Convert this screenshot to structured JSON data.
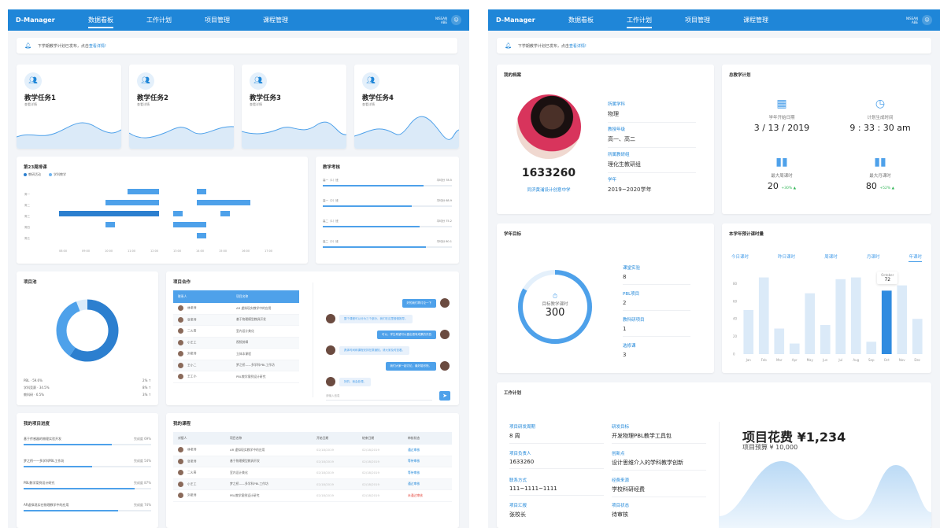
{
  "left": {
    "brand": "D-Manager",
    "nav": [
      "数据看板",
      "工作计划",
      "项目管理",
      "课程管理"
    ],
    "user_name": "NISSAN",
    "user_sub": "ABE",
    "notice_text": "下学期教学计划已发布，点击",
    "notice_link": "查看详情!",
    "tasks": [
      {
        "title": "教学任务1",
        "sub": "查看详情"
      },
      {
        "title": "教学任务2",
        "sub": "查看详情"
      },
      {
        "title": "教学任务3",
        "sub": "查看详情"
      },
      {
        "title": "教学任务4",
        "sub": "查看详情"
      }
    ],
    "schedule": {
      "title": "第23周排课",
      "legend": [
        "教研活动",
        "学科教学"
      ],
      "rows": [
        "周一",
        "周二",
        "周三",
        "周四",
        "周五"
      ],
      "ticks": [
        "08:00",
        "09:00",
        "10:00",
        "11:00",
        "12:00",
        "13:00",
        "14:00",
        "15:00",
        "16:00",
        "17:00"
      ]
    },
    "exam": {
      "title": "教学考核",
      "rows": [
        {
          "label": "高一（1）班",
          "val": "平均分 78.5",
          "pct": 0.8
        },
        {
          "label": "高一（2）班",
          "val": "平均分 68.9",
          "pct": 0.7
        },
        {
          "label": "高二（1）班",
          "val": "平均分 75.2",
          "pct": 0.78
        },
        {
          "label": "高二（2）班",
          "val": "平均分 80.1",
          "pct": 0.82
        }
      ]
    },
    "project_pie": {
      "title": "项目池",
      "items": [
        {
          "label": "PBL · 59.6%",
          "val": "2% ↑"
        },
        {
          "label": "学科竞赛 · 34.5%",
          "val": "8% ↑"
        },
        {
          "label": "教科研 · 6.5%",
          "val": "3% ↑"
        }
      ],
      "values": [
        59.6,
        34.5,
        6.5
      ]
    },
    "collab": {
      "title": "项目合作",
      "headers": [
        "联系人",
        "项目名称"
      ],
      "rows": [
        {
          "name": "林老师",
          "proj": "AR 虚拟现实教学中的应用"
        },
        {
          "name": "张老师",
          "proj": "基于物理模型教具开发"
        },
        {
          "name": "二火哥",
          "proj": "室内设计美化"
        },
        {
          "name": "小王工",
          "proj": "视频剪辑"
        },
        {
          "name": "刘老师",
          "proj": "立体本课程"
        },
        {
          "name": "王小二",
          "proj": "梦之桥——多学科PBL工作坊"
        },
        {
          "name": "王工小",
          "proj": "PBL教学案例设计研究"
        }
      ],
      "chat": [
        "好的我们再讨论一下",
        "整个课程可以分为三个部分，我们在这里慢慢推导。",
        "可以，学生希望可以做出很有成果的东西",
        "具体时间和课程安排在群通知，请大家及时查看。",
        "我们大家一起讨论，最好能尽快。",
        "好的，我会处理。"
      ],
      "chat_placeholder": "请输入信息"
    },
    "my_projects": {
      "title": "我的项目进度",
      "rows": [
        {
          "label": "基于传感器的物理实验开发",
          "val": "完成度 69%",
          "pct": 0.69
        },
        {
          "label": "梦之桥——多学科PBL工作坊",
          "val": "完成度 54%",
          "pct": 0.54
        },
        {
          "label": "PBL数学案例设计研究",
          "val": "完成度 87%",
          "pct": 0.87
        },
        {
          "label": "AR虚拟现实在物理教学中的应用",
          "val": "完成度 74%",
          "pct": 0.74
        }
      ]
    },
    "my_courses": {
      "title": "我的课程",
      "headers": [
        "对接人",
        "项目名称",
        "开始日期",
        "结束日期",
        "审核状态"
      ],
      "rows": [
        {
          "name": "林老师",
          "proj": "AR 虚拟现实教学中的应用",
          "start": "02/18/2019",
          "end": "02/18/2019",
          "status": "通过审核"
        },
        {
          "name": "张老师",
          "proj": "基于物理模型教具开发",
          "start": "02/18/2019",
          "end": "02/18/2019",
          "status": "等待审核"
        },
        {
          "name": "二火哥",
          "proj": "室内设计美化",
          "start": "02/18/2019",
          "end": "02/18/2019",
          "status": "等待审核"
        },
        {
          "name": "小王工",
          "proj": "梦之桥——多学科PBL工作坊",
          "start": "02/18/2019",
          "end": "02/18/2019",
          "status": "通过审核"
        },
        {
          "name": "刘老师",
          "proj": "PBL教学案例设计研究",
          "start": "02/18/2019",
          "end": "02/18/2019",
          "status": "未通过审核"
        }
      ]
    }
  },
  "right": {
    "brand": "D-Manager",
    "nav": [
      "数据看板",
      "工作计划",
      "项目管理",
      "课程管理"
    ],
    "user_name": "NISSAN",
    "user_sub": "ABE",
    "notice_text": "下学期教学计划已发布，点击",
    "notice_link": "查看详情!",
    "profile": {
      "title": "我的档案",
      "id": "1633260",
      "school": "同济黄浦设计创意中学",
      "fields": [
        {
          "label": "所属学科",
          "value": "物理"
        },
        {
          "label": "教授年级",
          "value": "高一、高二"
        },
        {
          "label": "所属教研组",
          "value": "理化生教研组"
        },
        {
          "label": "学年",
          "value": "2019~2020学年"
        }
      ]
    },
    "plan": {
      "title": "总教学计划",
      "items": [
        {
          "label": "学年开始日期",
          "value": "3 / 13 / 2019",
          "up": ""
        },
        {
          "label": "计划生成时间",
          "value": "9 : 33 : 30 am",
          "up": ""
        },
        {
          "label": "最大周课时",
          "value": "20",
          "up": "+30% ▲"
        },
        {
          "label": "最大月课时",
          "value": "80",
          "up": "+52% ▲"
        }
      ]
    },
    "goal": {
      "title": "学年目标",
      "center_label": "目标教学课时",
      "center_value": "300",
      "items": [
        {
          "label": "课堂实验",
          "value": "8"
        },
        {
          "label": "PBL项目",
          "value": "2"
        },
        {
          "label": "教科研项目",
          "value": "1"
        },
        {
          "label": "选修课",
          "value": "3"
        }
      ]
    },
    "hours": {
      "title": "本学年预计课时量",
      "tabs": [
        "今日课时",
        "昨日课时",
        "周课时",
        "月课时",
        "年课时"
      ],
      "tooltip_month": "October",
      "tooltip_value": "72"
    },
    "work": {
      "title": "工作计划",
      "items": [
        {
          "label": "项目研发周期",
          "value": "8 周"
        },
        {
          "label": "研发目标",
          "value": "开发物理PBL教学工具包"
        },
        {
          "label": "项目负责人",
          "value": "1633260"
        },
        {
          "label": "创新点",
          "value": "设计思维介入的学科教学创新"
        },
        {
          "label": "联系方式",
          "value": "111~1111~1111"
        },
        {
          "label": "经费来源",
          "value": "学校科研经费"
        },
        {
          "label": "项目汇报",
          "value": "张校长"
        },
        {
          "label": "项目状态",
          "value": "待审核"
        }
      ],
      "cost": "项目花费 ¥1,234",
      "budget": "项目预算 ¥ 10,000"
    }
  },
  "chart_data": {
    "type": "bar",
    "title": "本学年预计课时量",
    "categories": [
      "Jan",
      "Feb",
      "Mar",
      "Apr",
      "May",
      "Jun",
      "Jul",
      "Aug",
      "Sep",
      "Oct",
      "Nov",
      "Dec"
    ],
    "values": [
      50,
      87,
      29,
      12,
      69,
      33,
      85,
      87,
      14,
      72,
      78,
      40
    ],
    "yticks": [
      "0",
      "20",
      "40",
      "60",
      "80"
    ],
    "ylim": [
      0,
      100
    ],
    "highlight": "Oct"
  }
}
